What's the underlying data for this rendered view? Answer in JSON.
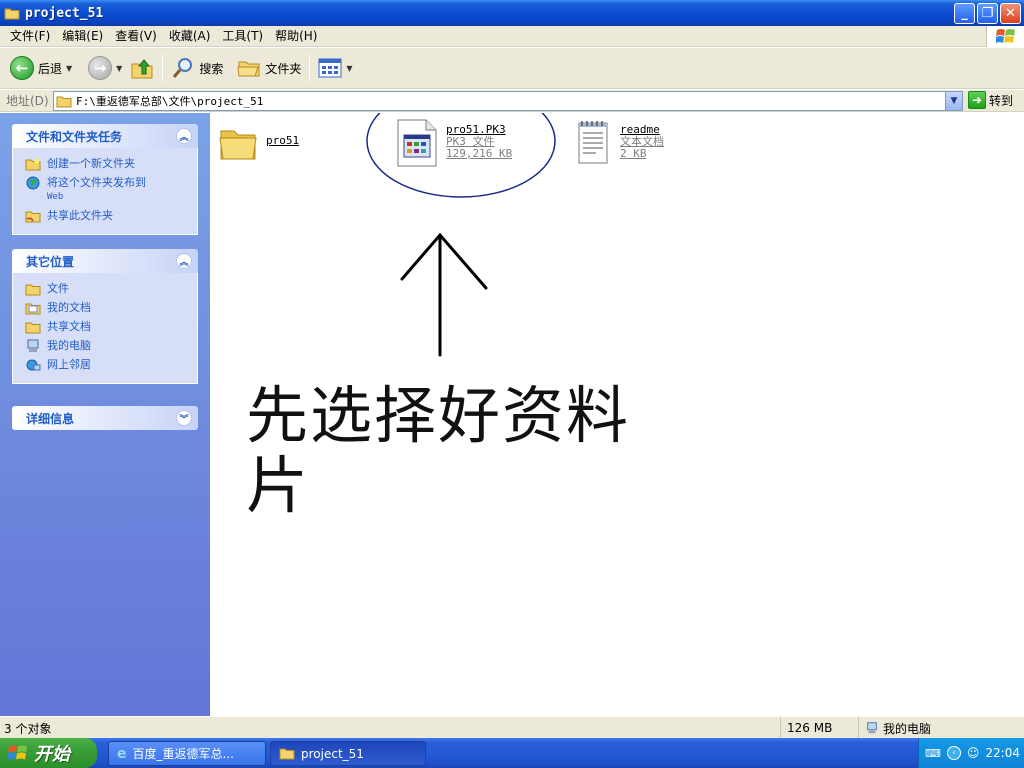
{
  "window": {
    "title": "project_51"
  },
  "menu": [
    "文件(F)",
    "编辑(E)",
    "查看(V)",
    "收藏(A)",
    "工具(T)",
    "帮助(H)"
  ],
  "toolbar": {
    "back": "后退",
    "search": "搜索",
    "folders": "文件夹"
  },
  "address": {
    "label": "地址(D)",
    "path": "F:\\重返德军总部\\文件\\project_51",
    "go": "转到"
  },
  "panels": {
    "tasks": {
      "title": "文件和文件夹任务",
      "items": [
        "创建一个新文件夹",
        "将这个文件夹发布到",
        "共享此文件夹"
      ],
      "web": "Web"
    },
    "places": {
      "title": "其它位置",
      "items": [
        "文件",
        "我的文档",
        "共享文档",
        "我的电脑",
        "网上邻居"
      ]
    },
    "details": {
      "title": "详细信息"
    }
  },
  "files": [
    {
      "name": "pro51",
      "type": "",
      "size": ""
    },
    {
      "name": "pro51.PK3",
      "type": "PK3 文件",
      "size": "129,216 KB"
    },
    {
      "name": "readme",
      "type": "文本文档",
      "size": "2 KB"
    }
  ],
  "annotation": {
    "text": "先选择好资料片"
  },
  "status": {
    "count": "3 个对象",
    "size": "126 MB",
    "location": "我的电脑"
  },
  "taskbar": {
    "start": "开始",
    "items": [
      "百度_重返德军总...",
      "project_51"
    ],
    "clock": "22:04"
  },
  "colors": {
    "accent": "#0b4cd0",
    "sidebar": "#6c84dc",
    "task_link": "#215dc6"
  }
}
